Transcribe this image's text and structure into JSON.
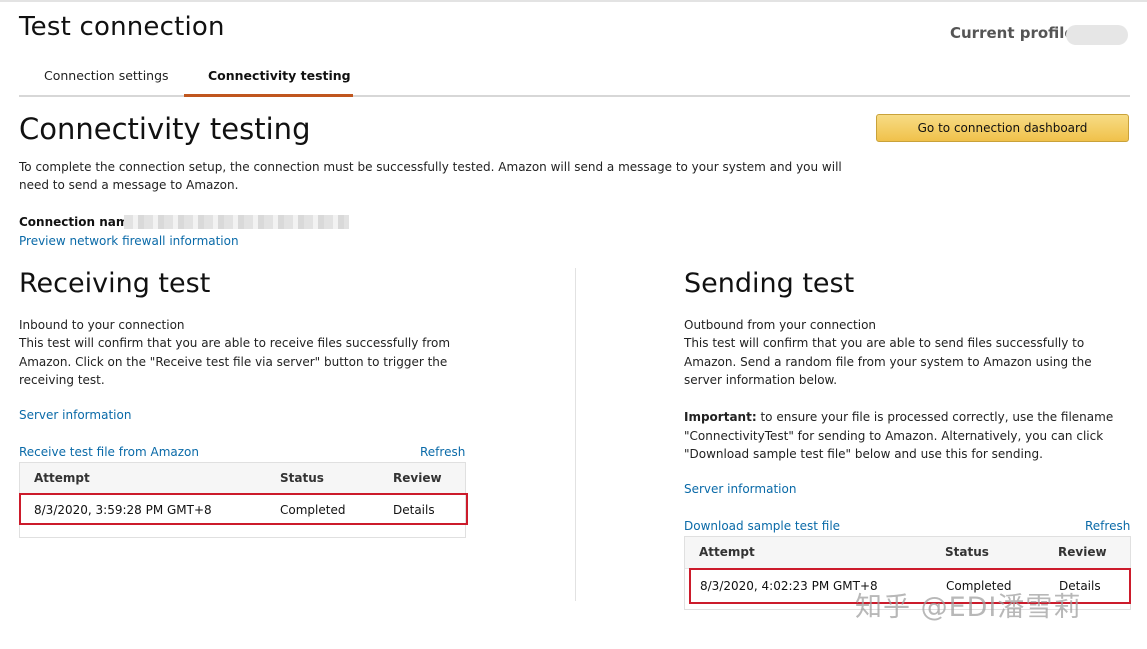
{
  "header": {
    "title": "Test connection",
    "current_profile_label": "Current profile"
  },
  "tabs": [
    {
      "label": "Connection settings"
    },
    {
      "label": "Connectivity testing",
      "active": true
    }
  ],
  "section": {
    "title": "Connectivity testing",
    "dashboard_button": "Go to connection dashboard",
    "intro": "To complete the connection setup, the connection must be successfully tested. Amazon will send a message to your system and you will need to send a message to Amazon.",
    "connection_name_label": "Connection name",
    "firewall_link": "Preview network firewall information"
  },
  "receiving": {
    "title": "Receiving test",
    "subtitle": "Inbound to your connection",
    "description": "This test will confirm that you are able to receive files successfully from Amazon. Click on the \"Receive test file via server\" button to trigger the receiving test.",
    "server_link": "Server information",
    "file_link": "Receive test file from Amazon",
    "refresh_link": "Refresh",
    "table": {
      "headers": [
        "Attempt",
        "Status",
        "Review"
      ],
      "rows": [
        {
          "attempt": "8/3/2020, 3:59:28 PM GMT+8",
          "status": "Completed",
          "review": "Details"
        }
      ]
    }
  },
  "sending": {
    "title": "Sending test",
    "subtitle": "Outbound from your connection",
    "description": "This test will confirm that you are able to send files successfully to Amazon. Send a random file from your system to Amazon using the server information below.",
    "important_label": "Important:",
    "important_text": "to ensure your file is processed correctly, use the filename \"ConnectivityTest\" for sending to Amazon. Alternatively, you can click \"Download sample test file\" below and use this for sending.",
    "server_link": "Server information",
    "download_link": "Download sample test file",
    "refresh_link": "Refresh",
    "table": {
      "headers": [
        "Attempt",
        "Status",
        "Review"
      ],
      "rows": [
        {
          "attempt": "8/3/2020, 4:02:23 PM GMT+8",
          "status": "Completed",
          "review": "Details"
        }
      ]
    }
  },
  "watermark": "知乎 @EDI潘雪莉",
  "colors": {
    "link": "#0a6aa8",
    "tab_accent": "#c0561e",
    "button": "#f0c14b",
    "highlight": "#cc1b2b"
  }
}
